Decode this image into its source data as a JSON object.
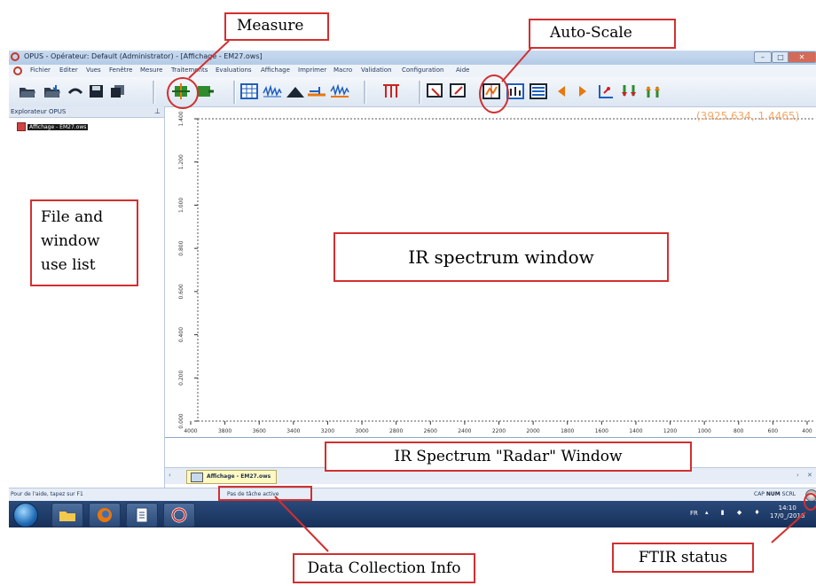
{
  "window": {
    "title": "OPUS - Opérateur: Default  (Administrator) - [Affichage - EM27.ows]",
    "buttons": {
      "minimize": "–",
      "maximize": "□",
      "close": "✕"
    }
  },
  "menubar": {
    "items": [
      "Fichier",
      "Editer",
      "Vues",
      "Fenêtre",
      "Mesure",
      "Traitements",
      "Evaluations",
      "Affichage",
      "Imprimer",
      "Macro",
      "Validation",
      "Configuration",
      "Aide"
    ]
  },
  "toolbar": {
    "icons": [
      "open-folder-icon",
      "open-folder-down-icon",
      "undo-icon",
      "save-icon",
      "copy-icon",
      "measure-icon",
      "measure-repeat-icon",
      "table-icon",
      "spectrum-icon",
      "peak-icon",
      "baseline-icon",
      "spectrum-compare-icon",
      "peak-pick-icon",
      "display-icon",
      "display-overlay-icon",
      "auto-scale-icon",
      "scale-y-icon",
      "expand-icon",
      "arrow-left-icon",
      "arrow-right-icon",
      "crosshair-icon",
      "shift-down-icon",
      "shift-up-icon"
    ],
    "colors": {
      "measure": "#2e8b2e",
      "accent": "#1f5fbf",
      "warn": "#e8770e",
      "red": "#cc2222"
    }
  },
  "explorer": {
    "title": "Explorateur OPUS",
    "files": [
      "Affichage - EM27.ows"
    ]
  },
  "spectrum": {
    "coord_readout": "(3925.634, 1.4465)",
    "y_ticks": [
      "1.400",
      "1.200",
      "1.000",
      "0.800",
      "0.600",
      "0.400",
      "0.200",
      "0.000"
    ],
    "x_ticks": [
      "4000",
      "3800",
      "3600",
      "3400",
      "3200",
      "3000",
      "2800",
      "2600",
      "2400",
      "2200",
      "2000",
      "1800",
      "1600",
      "1400",
      "1200",
      "1000",
      "800",
      "600",
      "400"
    ]
  },
  "doc_tab": {
    "label": "Affichage - EM27.ows"
  },
  "statusbar": {
    "help": "Pour de l'aide, tapez sur F1",
    "task": "Pas de tâche active",
    "cap": "CAP",
    "num": "NUM",
    "scrl": "SCRL"
  },
  "taskbar": {
    "lang": "FR",
    "time": "14:10",
    "date": "17/0_/2018"
  },
  "annotations": {
    "measure": "Measure",
    "auto_scale": "Auto-Scale",
    "file_list": [
      "File and",
      "window",
      "use list"
    ],
    "ir_window": "IR spectrum window",
    "radar": "IR Spectrum \"Radar\" Window",
    "data_info": "Data Collection Info",
    "ftir_status": "FTIR status"
  }
}
